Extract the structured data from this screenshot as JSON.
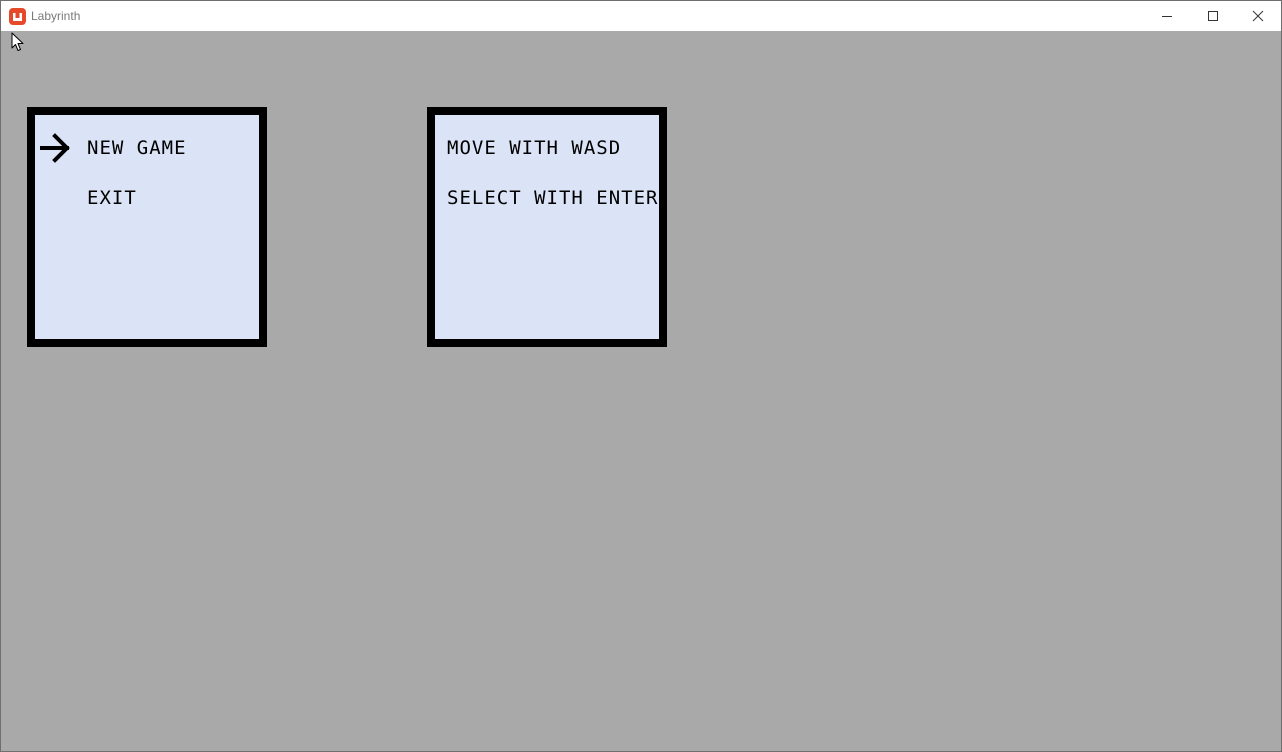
{
  "window": {
    "title": "Labyrinth",
    "app_icon": "monogame-logo-icon",
    "controls": [
      "minimize-icon",
      "maximize-icon",
      "close-icon"
    ]
  },
  "menu": {
    "items": [
      {
        "label": "NEW GAME",
        "selected": true
      },
      {
        "label": "EXIT",
        "selected": false
      }
    ],
    "selector_icon": "arrow-right-icon"
  },
  "help": {
    "lines": [
      "MOVE WITH WASD",
      "SELECT WITH ENTER"
    ]
  },
  "colors": {
    "background": "#a9a9a9",
    "panel_fill": "#dbe3f6",
    "panel_border": "#000000",
    "app_icon": "#e5492a"
  }
}
